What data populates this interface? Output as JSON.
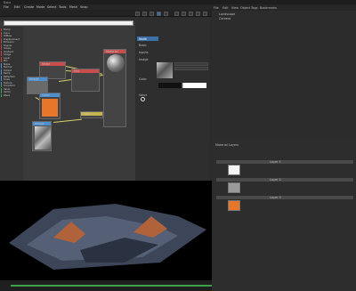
{
  "window": {
    "title": "Bake"
  },
  "menu": {
    "items": [
      "File",
      "Edit",
      "Create",
      "Mode",
      "Select",
      "Tools",
      "Mesh",
      "Snap",
      "Animate",
      "Simulate",
      "Render",
      "Extensions",
      "Window",
      "Help"
    ]
  },
  "node_editor": {
    "search_placeholder": "",
    "node_list": [
      "Bump",
      "Color",
      "Diffuse",
      "Displacement",
      "Emission",
      "Fresnel",
      "Glossy",
      "Gradient",
      "Image",
      "Layer",
      "Mix",
      "Noise",
      "Normal",
      "Output",
      "Ramp",
      "Reflection",
      "Scale",
      "Texture",
      "Transform",
      "Value",
      "Vector",
      "Wave"
    ],
    "nodes": [
      {
        "title": "Noise"
      },
      {
        "title": "Image"
      },
      {
        "title": "Color"
      },
      {
        "title": "Mix"
      },
      {
        "title": "Image"
      },
      {
        "title": "Value"
      },
      {
        "title": "Material"
      }
    ]
  },
  "attribute_panel": {
    "tab_label": "Node",
    "labels": [
      "Basic",
      "Inputs",
      "Image",
      "Color",
      "Value"
    ]
  },
  "object_manager": {
    "menu": [
      "File",
      "Edit",
      "View",
      "Object",
      "Tags",
      "Bookmarks"
    ],
    "items": [
      "Landscape",
      "Camera"
    ]
  },
  "material_layers": {
    "title": "Material Layers",
    "layers": [
      {
        "name": "Layer 1",
        "color": "#f5f5f5"
      },
      {
        "name": "Layer 2",
        "color": "#9a9a9a"
      },
      {
        "name": "Layer 3",
        "color": "#e8762a"
      }
    ]
  },
  "colors": {
    "accent": "#3d6fa8",
    "wire": "#d6d26a",
    "orange": "#e8762a",
    "progress": "#3fa04a"
  },
  "viewport": {
    "overlay_lines": [
      "",
      "",
      ""
    ]
  }
}
